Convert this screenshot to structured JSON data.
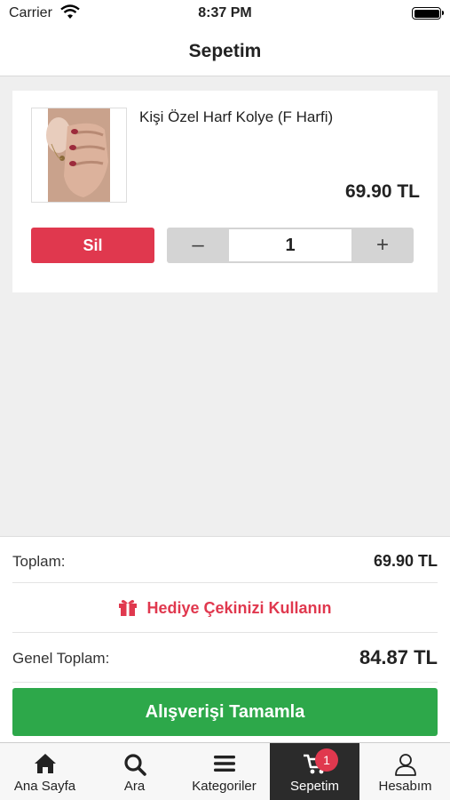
{
  "status_bar": {
    "carrier": "Carrier",
    "time": "8:37 PM"
  },
  "header": {
    "title": "Sepetim"
  },
  "cart": {
    "items": [
      {
        "name": "Kişi Özel Harf Kolye (F Harfi)",
        "price": "69.90 TL",
        "quantity": "1",
        "delete_label": "Sil",
        "minus_label": "–",
        "plus_label": "+"
      }
    ]
  },
  "summary": {
    "total_label": "Toplam:",
    "total_value": "69.90 TL",
    "gift_label": "Hediye Çekinizi Kullanın",
    "grand_total_label": "Genel Toplam:",
    "grand_total_value": "84.87 TL",
    "checkout_label": "Alışverişi Tamamla"
  },
  "tabbar": {
    "tabs": [
      {
        "label": "Ana Sayfa",
        "icon": "home-icon"
      },
      {
        "label": "Ara",
        "icon": "search-icon"
      },
      {
        "label": "Kategoriler",
        "icon": "menu-icon"
      },
      {
        "label": "Sepetim",
        "icon": "cart-icon",
        "active": true,
        "badge": "1"
      },
      {
        "label": "Hesabım",
        "icon": "user-icon"
      }
    ]
  },
  "colors": {
    "accent_red": "#e0384e",
    "checkout_green": "#2da84a",
    "active_tab": "#2b2b2b"
  }
}
